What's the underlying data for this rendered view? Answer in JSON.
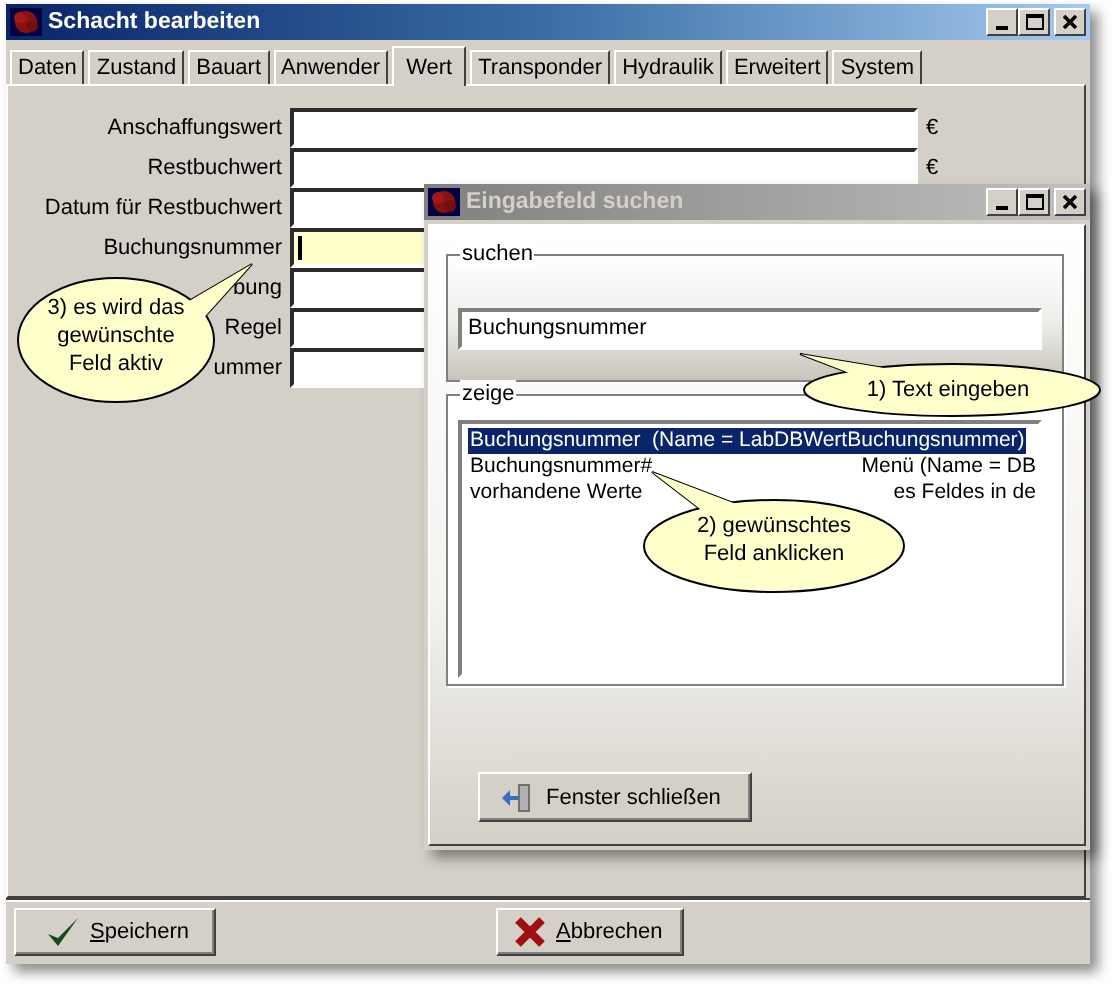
{
  "window": {
    "title": "Schacht bearbeiten"
  },
  "tabs": [
    {
      "label": "Daten",
      "selected": false
    },
    {
      "label": "Zustand",
      "selected": false
    },
    {
      "label": "Bauart",
      "selected": false
    },
    {
      "label": "Anwender",
      "selected": false
    },
    {
      "label": "Wert",
      "selected": true
    },
    {
      "label": "Transponder",
      "selected": false
    },
    {
      "label": "Hydraulik",
      "selected": false
    },
    {
      "label": "Erweitert",
      "selected": false
    },
    {
      "label": "System",
      "selected": false
    }
  ],
  "fields": [
    {
      "label": "Anschaffungswert",
      "unit": "€",
      "focused": false
    },
    {
      "label": "Restbuchwert",
      "unit": "€",
      "focused": false
    },
    {
      "label": "Datum für Restbuchwert",
      "focused": false
    },
    {
      "label": "Buchungsnummer",
      "focused": true
    },
    {
      "label": "bung",
      "focused": false
    },
    {
      "label": "Regel",
      "focused": false
    },
    {
      "label": "ummer",
      "focused": false
    }
  ],
  "buttons": [
    {
      "label": "Speichern",
      "kind": "save"
    },
    {
      "label": "Abbrechen",
      "kind": "cancel"
    }
  ],
  "dialog": {
    "title": "Eingabefeld suchen",
    "search_group": {
      "legend": "suchen",
      "value": "Buchungsnummer"
    },
    "results_group": {
      "legend": "zeige",
      "items": [
        {
          "parts": [
            "Buchungsnummer  (Name = LabDBWertBuchungsnummer)"
          ],
          "selected": true
        },
        {
          "parts": [
            "Buchungsnummer#",
            "Menü  (Name = DB"
          ],
          "selected": false
        },
        {
          "parts": [
            "vorhandene Werte",
            "es Feldes in de"
          ],
          "selected": false
        }
      ]
    },
    "close_button": "Fenster schließen"
  },
  "callouts": [
    {
      "text": "1) Text eingeben"
    },
    {
      "text": "2) gewünschtes Feld anklicken"
    },
    {
      "text": "3) es wird das gewünschte Feld aktiv"
    }
  ]
}
